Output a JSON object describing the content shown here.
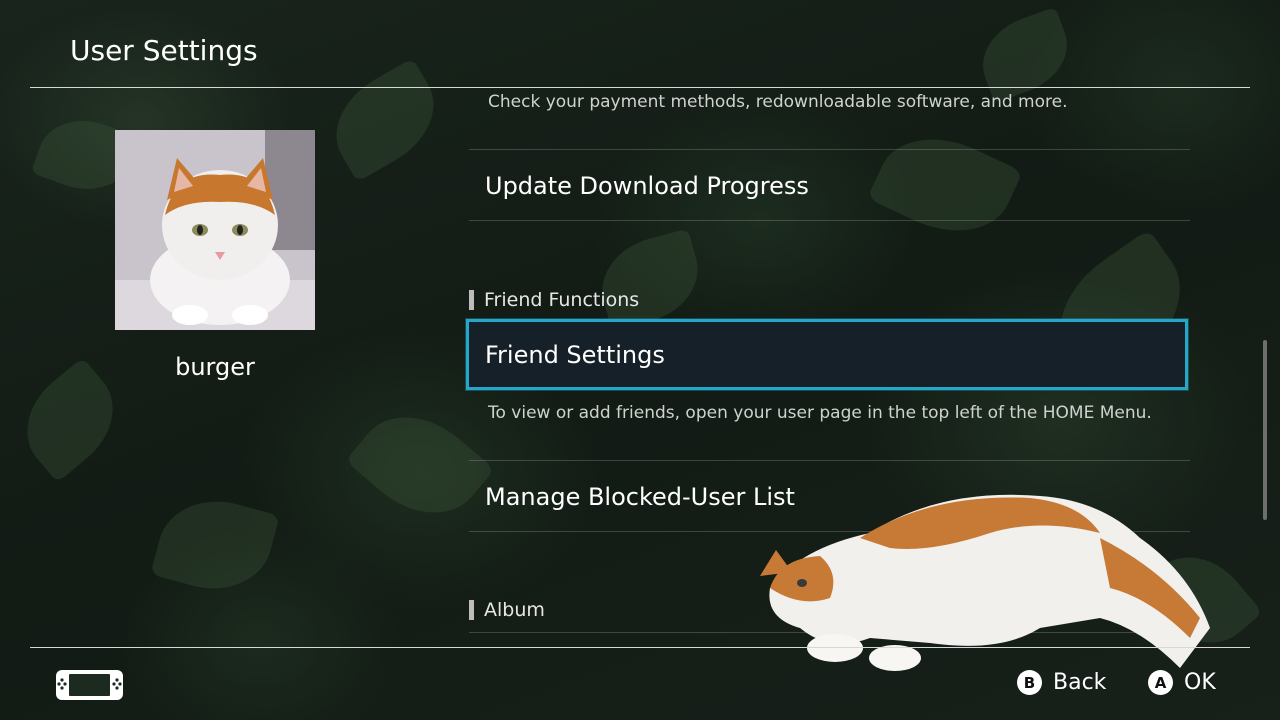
{
  "header": {
    "title": "User Settings"
  },
  "user": {
    "name": "burger"
  },
  "list": {
    "top_description": "Check your payment methods, redownloadable software, and more.",
    "items": [
      {
        "label": "Update Download Progress"
      },
      {
        "label": "Friend Settings",
        "description": "To view or add friends, open your user page in the top left of the HOME Menu."
      },
      {
        "label": "Manage Blocked-User List"
      }
    ],
    "sections": [
      {
        "label": "Friend Functions"
      },
      {
        "label": "Album"
      }
    ]
  },
  "footer": {
    "back": {
      "key": "B",
      "label": "Back"
    },
    "ok": {
      "key": "A",
      "label": "OK"
    }
  },
  "colors": {
    "selection_border": "#27a7c8",
    "background": "#1d2a20"
  }
}
